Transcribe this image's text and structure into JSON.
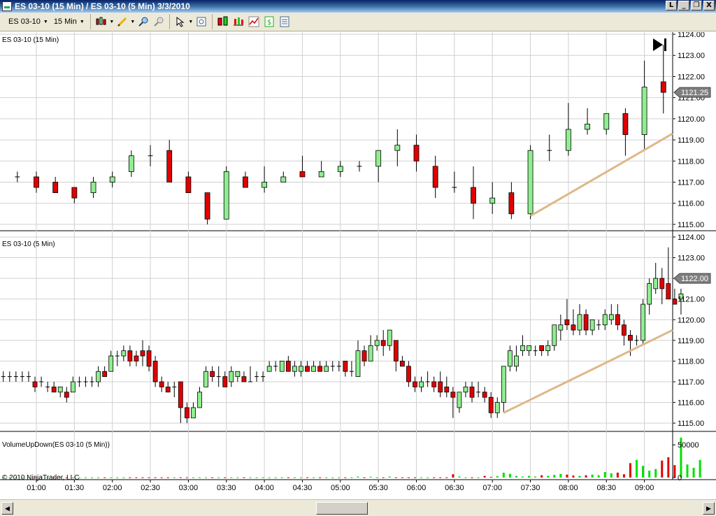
{
  "window": {
    "title": "ES 03-10 (15 Min) / ES 03-10 (5 Min)  3/3/2010",
    "buttons": [
      "L",
      "_",
      "❐",
      "X"
    ]
  },
  "toolbar": {
    "instrument": "ES 03-10",
    "interval": "15 Min",
    "icons": [
      "candlestick-icon",
      "pencil-draw-icon",
      "zoom-in-icon",
      "zoom-out-icon",
      "cursor-icon",
      "magnify-icon",
      "data-box-icon",
      "indicators-icon",
      "strategies-icon",
      "dollar-icon",
      "properties-icon"
    ]
  },
  "panels": {
    "top_label": "ES 03-10 (15 Min)",
    "mid_label": "ES 03-10 (5 Min)",
    "vol_label": "VolumeUpDown(ES 03-10 (5 Min))",
    "copyright": "© 2010 NinjaTrader, LLC",
    "top_price_tag": "1121.25",
    "mid_price_tag": "1122.00",
    "vol_axis": [
      "50000",
      "0"
    ]
  },
  "chart_data": [
    {
      "type": "candlestick",
      "title": "ES 03-10 (15 Min)",
      "ylim": [
        1114.7,
        1124.1
      ],
      "yticks": [
        1115.0,
        1116.0,
        1117.0,
        1118.0,
        1119.0,
        1120.0,
        1121.0,
        1122.0,
        1123.0,
        1124.0
      ],
      "yticklabels": [
        "1115.00",
        "1116.00",
        "1117.00",
        "1118.00",
        "1119.00",
        "1120.00",
        "1121.00",
        "1122.00",
        "1123.00",
        "1124.00"
      ],
      "last_price": 1121.25,
      "candles": [
        {
          "t": "00:45",
          "o": 1117.25,
          "h": 1117.5,
          "l": 1117.0,
          "c": 1117.25
        },
        {
          "t": "01:00",
          "o": 1117.25,
          "h": 1117.5,
          "l": 1116.5,
          "c": 1116.75
        },
        {
          "t": "01:15",
          "o": 1117.0,
          "h": 1117.25,
          "l": 1116.5,
          "c": 1116.5
        },
        {
          "t": "01:30",
          "o": 1116.75,
          "h": 1116.75,
          "l": 1116.0,
          "c": 1116.25
        },
        {
          "t": "01:45",
          "o": 1116.5,
          "h": 1117.25,
          "l": 1116.25,
          "c": 1117.0
        },
        {
          "t": "02:00",
          "o": 1117.0,
          "h": 1117.5,
          "l": 1116.75,
          "c": 1117.25
        },
        {
          "t": "02:15",
          "o": 1117.5,
          "h": 1118.5,
          "l": 1117.25,
          "c": 1118.25
        },
        {
          "t": "02:30",
          "o": 1118.25,
          "h": 1118.75,
          "l": 1117.75,
          "c": 1118.25
        },
        {
          "t": "02:45",
          "o": 1118.5,
          "h": 1119.0,
          "l": 1117.0,
          "c": 1117.0
        },
        {
          "t": "03:00",
          "o": 1117.25,
          "h": 1117.5,
          "l": 1116.5,
          "c": 1116.5
        },
        {
          "t": "03:15",
          "o": 1116.5,
          "h": 1116.5,
          "l": 1115.0,
          "c": 1115.25
        },
        {
          "t": "03:30",
          "o": 1115.25,
          "h": 1117.75,
          "l": 1115.25,
          "c": 1117.5
        },
        {
          "t": "03:45",
          "o": 1117.25,
          "h": 1117.5,
          "l": 1116.75,
          "c": 1116.75
        },
        {
          "t": "04:00",
          "o": 1116.75,
          "h": 1117.75,
          "l": 1116.5,
          "c": 1117.0
        },
        {
          "t": "04:15",
          "o": 1117.0,
          "h": 1117.5,
          "l": 1117.0,
          "c": 1117.25
        },
        {
          "t": "04:30",
          "o": 1117.5,
          "h": 1118.25,
          "l": 1117.25,
          "c": 1117.25
        },
        {
          "t": "04:45",
          "o": 1117.25,
          "h": 1118.0,
          "l": 1117.25,
          "c": 1117.5
        },
        {
          "t": "05:00",
          "o": 1117.5,
          "h": 1118.0,
          "l": 1117.25,
          "c": 1117.75
        },
        {
          "t": "05:15",
          "o": 1117.75,
          "h": 1118.0,
          "l": 1117.5,
          "c": 1117.75
        },
        {
          "t": "05:30",
          "o": 1117.75,
          "h": 1118.5,
          "l": 1117.0,
          "c": 1118.5
        },
        {
          "t": "05:45",
          "o": 1118.5,
          "h": 1119.5,
          "l": 1117.75,
          "c": 1118.75
        },
        {
          "t": "06:00",
          "o": 1118.75,
          "h": 1119.25,
          "l": 1117.5,
          "c": 1118.0
        },
        {
          "t": "06:15",
          "o": 1117.75,
          "h": 1118.25,
          "l": 1116.25,
          "c": 1116.75
        },
        {
          "t": "06:30",
          "o": 1116.75,
          "h": 1117.5,
          "l": 1116.5,
          "c": 1116.75
        },
        {
          "t": "06:45",
          "o": 1116.75,
          "h": 1117.75,
          "l": 1115.25,
          "c": 1116.0
        },
        {
          "t": "07:00",
          "o": 1116.0,
          "h": 1117.0,
          "l": 1115.5,
          "c": 1116.25
        },
        {
          "t": "07:15",
          "o": 1116.5,
          "h": 1117.0,
          "l": 1115.25,
          "c": 1115.5
        },
        {
          "t": "07:30",
          "o": 1115.5,
          "h": 1118.75,
          "l": 1115.25,
          "c": 1118.5
        },
        {
          "t": "07:45",
          "o": 1118.5,
          "h": 1119.25,
          "l": 1118.0,
          "c": 1118.5
        },
        {
          "t": "08:00",
          "o": 1118.5,
          "h": 1120.75,
          "l": 1118.25,
          "c": 1119.5
        },
        {
          "t": "08:15",
          "o": 1119.5,
          "h": 1120.5,
          "l": 1119.25,
          "c": 1119.75
        },
        {
          "t": "08:30",
          "o": 1119.5,
          "h": 1120.25,
          "l": 1119.25,
          "c": 1120.25
        },
        {
          "t": "08:45",
          "o": 1120.25,
          "h": 1120.5,
          "l": 1118.25,
          "c": 1119.25
        },
        {
          "t": "09:00",
          "o": 1119.25,
          "h": 1122.75,
          "l": 1118.5,
          "c": 1121.5
        },
        {
          "t": "09:15",
          "o": 1121.75,
          "h": 1123.5,
          "l": 1120.25,
          "c": 1121.25
        }
      ],
      "trendline": {
        "start": {
          "t": "07:30",
          "price": 1115.4
        },
        "end": {
          "t": "edge",
          "price": 1119.3
        }
      }
    },
    {
      "type": "candlestick",
      "title": "ES 03-10 (5 Min)",
      "ylim": [
        1114.6,
        1124.1
      ],
      "yticks": [
        1115.0,
        1116.0,
        1117.0,
        1118.0,
        1119.0,
        1120.0,
        1121.0,
        1122.0,
        1123.0,
        1124.0
      ],
      "yticklabels": [
        "1115.00",
        "1116.00",
        "1117.00",
        "1118.00",
        "1119.00",
        "1120.00",
        "1121.00",
        "1122.00",
        "1123.00",
        "1124.00"
      ],
      "last_price": 1122.0,
      "candles": [
        [
          1117.25,
          1117.5,
          1117.0,
          1117.25
        ],
        [
          1117.25,
          1117.5,
          1117.0,
          1117.25
        ],
        [
          1117.25,
          1117.5,
          1117.0,
          1117.25
        ],
        [
          1117.25,
          1117.5,
          1117.0,
          1117.25
        ],
        [
          1117.25,
          1117.5,
          1117.0,
          1117.25
        ],
        [
          1117.0,
          1117.25,
          1116.5,
          1116.75
        ],
        [
          1117.0,
          1117.25,
          1116.75,
          1117.0
        ],
        [
          1116.75,
          1117.0,
          1116.5,
          1116.75
        ],
        [
          1116.75,
          1117.0,
          1116.5,
          1116.5
        ],
        [
          1116.5,
          1116.75,
          1116.25,
          1116.75
        ],
        [
          1116.5,
          1116.75,
          1116.0,
          1116.25
        ],
        [
          1116.5,
          1117.25,
          1116.5,
          1117.0
        ],
        [
          1117.0,
          1117.25,
          1116.75,
          1117.0
        ],
        [
          1117.0,
          1117.25,
          1116.75,
          1117.0
        ],
        [
          1117.0,
          1117.25,
          1116.75,
          1117.0
        ],
        [
          1117.0,
          1117.75,
          1116.75,
          1117.5
        ],
        [
          1117.5,
          1117.75,
          1117.25,
          1117.25
        ],
        [
          1117.5,
          1118.5,
          1117.5,
          1118.25
        ],
        [
          1118.25,
          1118.5,
          1117.75,
          1118.25
        ],
        [
          1118.25,
          1118.75,
          1118.0,
          1118.5
        ],
        [
          1118.5,
          1118.75,
          1117.75,
          1118.0
        ],
        [
          1118.25,
          1118.5,
          1117.75,
          1118.0
        ],
        [
          1118.5,
          1119.0,
          1117.75,
          1118.25
        ],
        [
          1118.5,
          1118.75,
          1117.5,
          1117.75
        ],
        [
          1118.0,
          1118.25,
          1116.75,
          1117.0
        ],
        [
          1117.0,
          1117.25,
          1116.5,
          1116.75
        ],
        [
          1116.75,
          1117.0,
          1116.5,
          1116.5
        ],
        [
          1116.75,
          1117.0,
          1116.25,
          1116.75
        ],
        [
          1117.0,
          1117.0,
          1115.0,
          1115.75
        ],
        [
          1115.75,
          1116.0,
          1115.0,
          1115.25
        ],
        [
          1115.25,
          1116.0,
          1115.25,
          1115.75
        ],
        [
          1115.75,
          1116.75,
          1115.75,
          1116.5
        ],
        [
          1116.75,
          1117.75,
          1116.75,
          1117.5
        ],
        [
          1117.5,
          1117.75,
          1117.0,
          1117.25
        ],
        [
          1117.25,
          1117.75,
          1116.75,
          1117.25
        ],
        [
          1117.25,
          1117.5,
          1116.75,
          1116.75
        ],
        [
          1117.0,
          1117.75,
          1116.75,
          1117.5
        ],
        [
          1117.25,
          1117.5,
          1117.0,
          1117.5
        ],
        [
          1117.25,
          1117.5,
          1117.0,
          1117.0
        ],
        [
          1117.0,
          1117.75,
          1117.0,
          1117.0
        ],
        [
          1117.25,
          1117.5,
          1117.0,
          1117.25
        ],
        [
          1117.25,
          1117.5,
          1117.0,
          1117.25
        ],
        [
          1117.5,
          1118.0,
          1117.5,
          1117.75
        ],
        [
          1117.75,
          1118.0,
          1117.5,
          1117.75
        ],
        [
          1117.5,
          1118.0,
          1117.5,
          1118.0
        ],
        [
          1118.0,
          1118.25,
          1117.5,
          1117.5
        ],
        [
          1117.5,
          1118.0,
          1117.25,
          1117.75
        ],
        [
          1117.5,
          1118.0,
          1117.25,
          1117.75
        ],
        [
          1117.75,
          1118.0,
          1117.5,
          1117.5
        ],
        [
          1117.5,
          1118.0,
          1117.5,
          1117.75
        ],
        [
          1117.75,
          1118.0,
          1117.5,
          1117.5
        ],
        [
          1117.5,
          1118.0,
          1117.5,
          1117.75
        ],
        [
          1117.75,
          1118.0,
          1117.5,
          1117.75
        ],
        [
          1117.75,
          1118.0,
          1117.5,
          1117.75
        ],
        [
          1118.0,
          1118.0,
          1117.25,
          1117.5
        ],
        [
          1117.5,
          1118.0,
          1117.25,
          1117.5
        ],
        [
          1117.25,
          1119.0,
          1117.25,
          1118.5
        ],
        [
          1118.5,
          1118.75,
          1117.75,
          1118.0
        ],
        [
          1118.0,
          1119.25,
          1118.0,
          1118.75
        ],
        [
          1118.75,
          1119.25,
          1118.5,
          1119.0
        ],
        [
          1119.0,
          1119.5,
          1118.25,
          1118.75
        ],
        [
          1118.75,
          1119.5,
          1118.5,
          1119.5
        ],
        [
          1119.0,
          1119.0,
          1117.5,
          1118.0
        ],
        [
          1118.0,
          1118.25,
          1117.75,
          1117.75
        ],
        [
          1117.75,
          1118.0,
          1116.75,
          1117.0
        ],
        [
          1117.0,
          1117.25,
          1116.5,
          1116.75
        ],
        [
          1116.75,
          1117.25,
          1116.5,
          1117.0
        ],
        [
          1117.0,
          1117.5,
          1116.75,
          1117.0
        ],
        [
          1117.0,
          1117.25,
          1116.5,
          1116.75
        ],
        [
          1117.0,
          1117.5,
          1116.25,
          1116.5
        ],
        [
          1116.75,
          1117.25,
          1116.25,
          1116.5
        ],
        [
          1116.5,
          1116.75,
          1115.25,
          1116.25
        ],
        [
          1115.75,
          1116.5,
          1115.5,
          1116.5
        ],
        [
          1116.5,
          1117.0,
          1116.25,
          1116.75
        ],
        [
          1116.75,
          1117.0,
          1116.0,
          1116.25
        ],
        [
          1116.5,
          1117.0,
          1116.25,
          1116.5
        ],
        [
          1116.5,
          1116.75,
          1116.0,
          1116.25
        ],
        [
          1116.25,
          1116.5,
          1115.25,
          1115.5
        ],
        [
          1115.5,
          1116.25,
          1115.25,
          1116.0
        ],
        [
          1116.0,
          1117.75,
          1115.5,
          1117.75
        ],
        [
          1117.75,
          1118.75,
          1117.5,
          1118.5
        ],
        [
          1117.75,
          1118.75,
          1117.5,
          1118.25
        ],
        [
          1118.5,
          1119.25,
          1118.25,
          1118.75
        ],
        [
          1118.5,
          1118.75,
          1118.25,
          1118.75
        ],
        [
          1118.5,
          1118.75,
          1118.25,
          1118.5
        ],
        [
          1118.75,
          1118.75,
          1118.25,
          1118.5
        ],
        [
          1118.5,
          1119.0,
          1118.25,
          1118.75
        ],
        [
          1118.75,
          1119.5,
          1118.5,
          1119.75
        ],
        [
          1119.5,
          1120.25,
          1119.0,
          1119.75
        ],
        [
          1120.0,
          1121.0,
          1119.5,
          1119.75
        ],
        [
          1119.75,
          1120.5,
          1119.25,
          1119.5
        ],
        [
          1119.5,
          1120.75,
          1119.25,
          1120.25
        ],
        [
          1120.25,
          1120.5,
          1119.25,
          1119.5
        ],
        [
          1119.5,
          1120.0,
          1119.25,
          1120.0
        ],
        [
          1119.75,
          1120.0,
          1119.5,
          1119.75
        ],
        [
          1119.75,
          1120.5,
          1119.5,
          1120.25
        ],
        [
          1120.0,
          1120.75,
          1119.75,
          1120.25
        ],
        [
          1120.25,
          1120.75,
          1119.5,
          1119.75
        ],
        [
          1119.75,
          1120.0,
          1118.75,
          1119.25
        ],
        [
          1119.25,
          1119.5,
          1118.25,
          1119.0
        ],
        [
          1119.0,
          1119.25,
          1118.75,
          1119.0
        ],
        [
          1119.0,
          1121.0,
          1118.75,
          1120.75
        ],
        [
          1120.75,
          1122.0,
          1120.25,
          1121.75
        ],
        [
          1121.5,
          1122.75,
          1121.25,
          1122.0
        ],
        [
          1122.0,
          1122.5,
          1120.75,
          1121.5
        ],
        [
          1121.75,
          1123.5,
          1121.0,
          1121.0
        ],
        [
          1121.0,
          1121.5,
          1120.75,
          1120.75
        ],
        [
          1121.0,
          1121.5,
          1120.25,
          1121.25
        ]
      ],
      "trendline": {
        "start": {
          "bar": 79,
          "price": 1115.5
        },
        "end": {
          "t": "edge",
          "price": 1119.5
        }
      }
    },
    {
      "type": "bar",
      "title": "VolumeUpDown(ES 03-10 (5 Min))",
      "ylim": [
        0,
        62000
      ],
      "yticks": [
        0,
        50000
      ],
      "colors": {
        "up": "#00e000",
        "down": "#e00000"
      },
      "note": "one bar per 5-min candle above; up=close>=open",
      "volumes": [
        300,
        300,
        300,
        300,
        300,
        300,
        300,
        300,
        300,
        300,
        300,
        300,
        300,
        300,
        300,
        300,
        300,
        300,
        300,
        300,
        300,
        300,
        300,
        300,
        300,
        300,
        300,
        300,
        300,
        300,
        300,
        300,
        300,
        300,
        300,
        300,
        300,
        300,
        300,
        300,
        300,
        300,
        300,
        300,
        300,
        300,
        300,
        300,
        300,
        300,
        300,
        300,
        300,
        300,
        300,
        300,
        1500,
        300,
        1200,
        300,
        300,
        1500,
        300,
        300,
        300,
        300,
        300,
        300,
        300,
        300,
        300,
        5000,
        1500,
        300,
        300,
        300,
        2500,
        1000,
        2000,
        7500,
        5500,
        2500,
        1500,
        2500,
        1500,
        3500,
        2500,
        4000,
        5500,
        4500,
        3000,
        2500,
        3500,
        4500,
        3500,
        8500,
        6500,
        7500,
        5000,
        22000,
        27000,
        18000,
        10500,
        13000,
        26000,
        31000,
        19000,
        61000,
        20000,
        15000,
        27000
      ]
    }
  ],
  "xaxis": {
    "labels": [
      "01:00",
      "01:30",
      "02:00",
      "02:30",
      "03:00",
      "03:30",
      "04:00",
      "04:30",
      "05:00",
      "05:30",
      "06:00",
      "06:30",
      "07:00",
      "07:30",
      "08:00",
      "08:30",
      "09:00"
    ],
    "start_hour": 0.75,
    "hours_per_label": 0.5
  },
  "colors": {
    "up_fill": "#90ee90",
    "down_fill": "#e00000",
    "border": "#000000",
    "trendline": "#deb887",
    "grid": "#d0d0d0"
  }
}
